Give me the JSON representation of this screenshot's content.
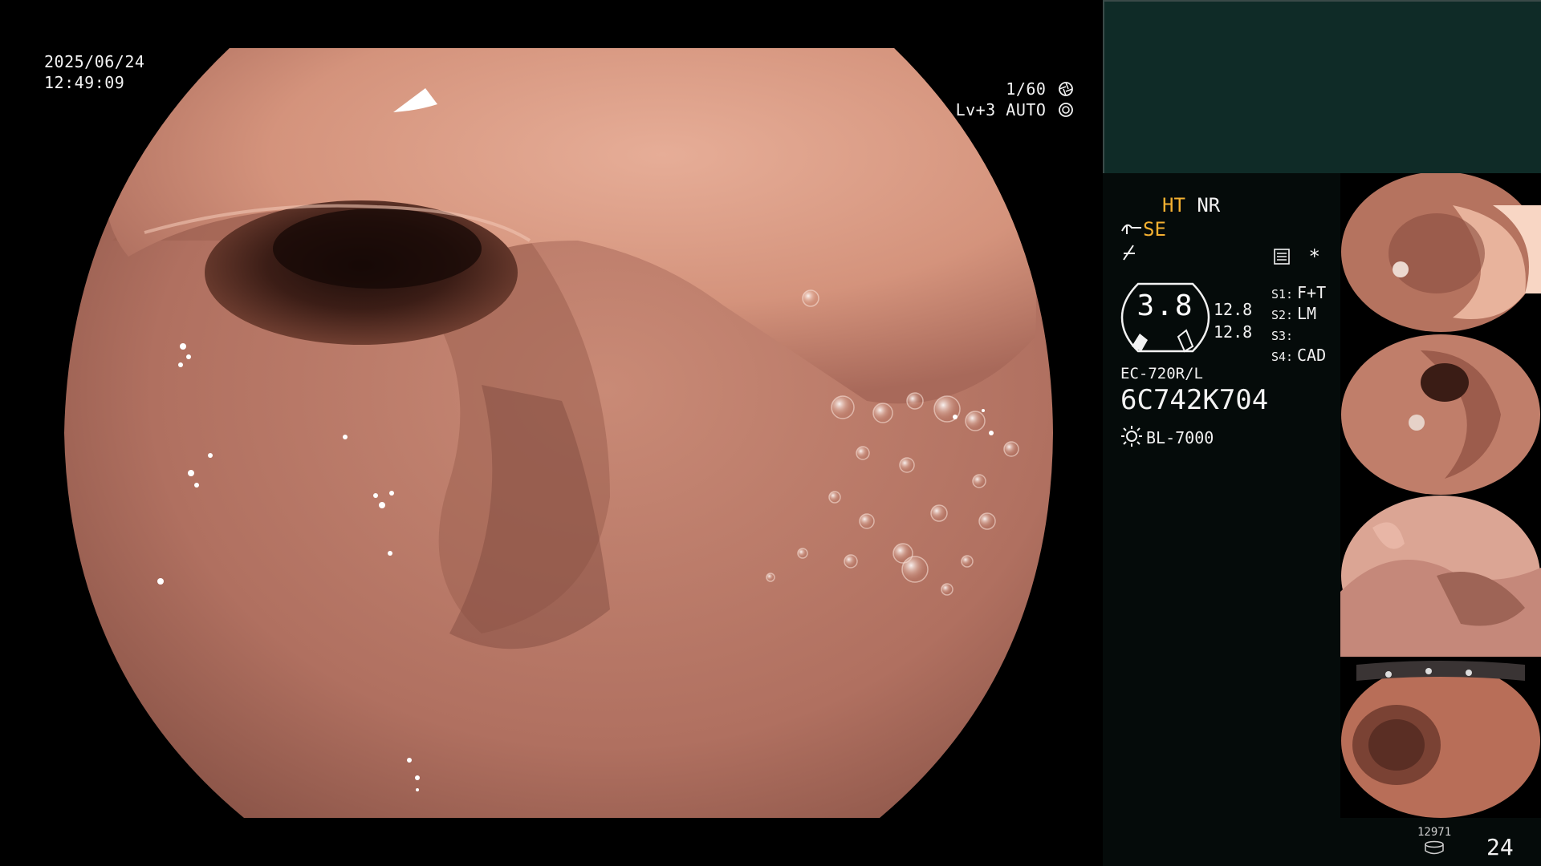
{
  "main_view": {
    "date": "2025/06/24",
    "time": "12:49:09",
    "shutter": "1/60",
    "shutter_icon": "aperture-icon",
    "level": "Lv+3",
    "mode": "AUTO",
    "mode_icon": "iris-icon"
  },
  "panel": {
    "header_color": "#0f2b27",
    "settings": {
      "ht": "HT",
      "nr": "NR",
      "se": "SE",
      "menu_icon": "memory-icon",
      "star": "*",
      "zoom": "3.8",
      "enhance_a": "12.8",
      "enhance_b": "12.8",
      "slots": [
        {
          "key": "S1:",
          "value": "F+T"
        },
        {
          "key": "S2:",
          "value": "LM"
        },
        {
          "key": "S3:",
          "value": ""
        },
        {
          "key": "S4:",
          "value": "CAD"
        }
      ],
      "scope_model": "EC-720R/L",
      "scope_serial": "6C742K704",
      "light_source": "BL-7000",
      "light_icon": "sun-icon"
    },
    "counter": "12971",
    "counter_icon": "storage-icon",
    "page": "24"
  },
  "colors": {
    "accent_orange": "#f5b131",
    "tissue": "#c88270",
    "panel_bg": "#050b0a"
  }
}
